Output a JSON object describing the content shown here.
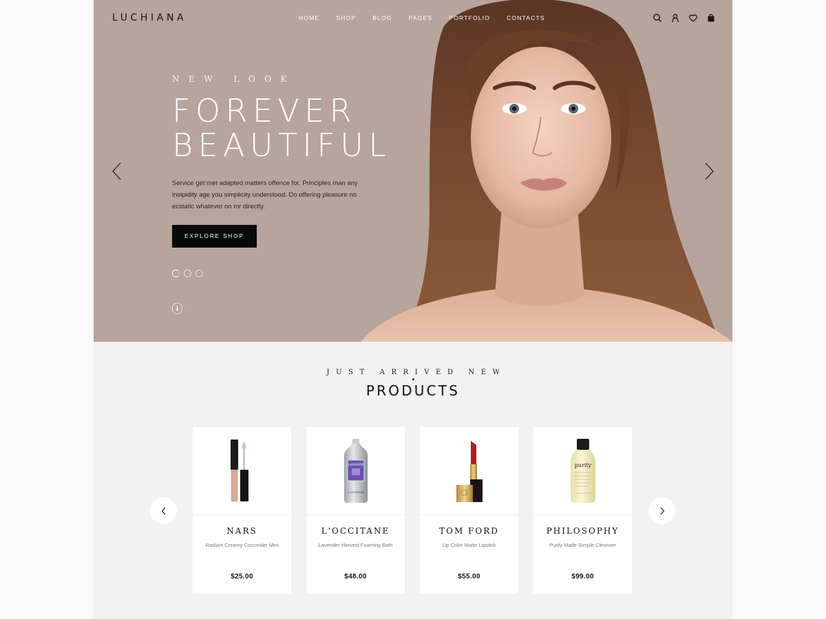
{
  "header": {
    "logo": "LUCHIANA",
    "menu": [
      "HOME",
      "SHOP",
      "BLOG",
      "PAGES",
      "PORTFOLIO",
      "CONTACTS"
    ],
    "icons": [
      "search-icon",
      "user-icon",
      "heart-icon",
      "bag-icon"
    ]
  },
  "hero": {
    "eyebrow": "NEW LOOK",
    "headline_line1": "FOREVER",
    "headline_line2": "BEAUTIFUL",
    "description": "Service get met adapted matters offence for. Principles man any insipidity age you simplicity understood. Do offering pleasure no ecstatic whatever on mr directly.",
    "cta_label": "EXPLORE SHOP",
    "slide_count": 3,
    "active_slide": 1,
    "background_color": "#b6a49d"
  },
  "products_section": {
    "kicker": "JUST ARRIVED NEW",
    "title": "PRODUCTS",
    "items": [
      {
        "brand": "NARS",
        "name": "Radiant Creamy Concealer Mini",
        "price": "$25.00",
        "image": "concealer"
      },
      {
        "brand": "L'OCCITANE",
        "name": "Lavender Harvest Foaming Bath",
        "price": "$48.00",
        "image": "foaming-bath-bottle"
      },
      {
        "brand": "TOM FORD",
        "name": "Lip Color Matte Lipstick",
        "price": "$55.00",
        "image": "lipstick"
      },
      {
        "brand": "PHILOSOPHY",
        "name": "Purity Made Simple Cleanser",
        "price": "$99.00",
        "image": "cleanser-bottle"
      }
    ]
  },
  "product_labels": {
    "bottle_label": "LAVANDE",
    "bottle_brand": "L'OCCITANE",
    "cleanser_label": "purity"
  }
}
